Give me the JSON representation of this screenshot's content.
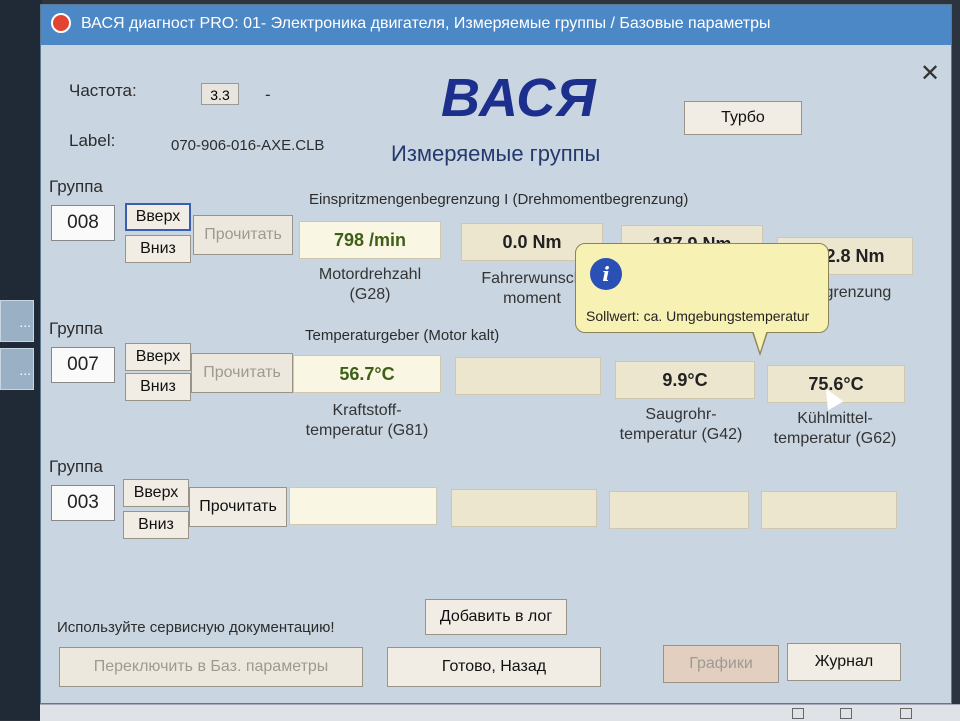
{
  "window": {
    "title": "ВАСЯ диагност PRO: 01- Электроника двигателя,  Измеряемые группы / Базовые параметры",
    "close_glyph": "✕"
  },
  "header": {
    "freq_label": "Частота:",
    "freq_value": "3.3",
    "freq_dash": "-",
    "label_label": "Label:",
    "label_value": "070-906-016-AXE.CLB",
    "brand": "ВАСЯ",
    "subtitle": "Измеряемые группы",
    "turbo_label": "Турбо"
  },
  "groups": [
    {
      "heading": "Группа",
      "number": "008",
      "up_label": "Вверх",
      "down_label": "Вниз",
      "read_label": "Прочитать",
      "title": "Einspritzmengenbegrenzung I (Drehmomentbegrenzung)",
      "values": [
        "798 /min",
        "0.0 Nm",
        "187.9 Nm",
        "182.8 Nm"
      ],
      "captions": [
        "Motordrehzahl (G28)",
        "Fahrerwunsch moment",
        "",
        "begrenzung"
      ]
    },
    {
      "heading": "Группа",
      "number": "007",
      "up_label": "Вверх",
      "down_label": "Вниз",
      "read_label": "Прочитать",
      "title": "Temperaturgeber (Motor kalt)",
      "values": [
        "56.7°C",
        "",
        "9.9°C",
        "75.6°C"
      ],
      "captions": [
        "Kraftstoff- temperatur (G81)",
        "",
        "Saugrohr- temperatur (G42)",
        "Kühlmittel- temperatur (G62)"
      ]
    },
    {
      "heading": "Группа",
      "number": "003",
      "up_label": "Вверх",
      "down_label": "Вниз",
      "read_label": "Прочитать",
      "title": "",
      "values": [
        "",
        "",
        "",
        ""
      ],
      "captions": [
        "",
        "",
        "",
        ""
      ]
    }
  ],
  "tooltip": {
    "icon": "i",
    "text": "Sollwert: ca. Umgebungstemperatur"
  },
  "footer": {
    "hint": "Используйте сервисную документацию!",
    "add_log_label": "Добавить в лог",
    "switch_label": "Переключить в Баз. параметры",
    "done_label": "Готово, Назад",
    "graphs_label": "Графики",
    "journal_label": "Журнал"
  }
}
